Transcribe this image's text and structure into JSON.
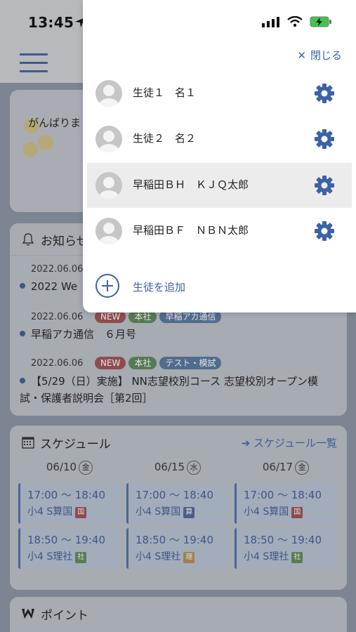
{
  "status_bar": {
    "time": "13:45"
  },
  "panel": {
    "close_label": "閉じる",
    "students": [
      {
        "name": "生徒１　名１",
        "selected": false
      },
      {
        "name": "生徒２　名２",
        "selected": false
      },
      {
        "name": "早稲田ＢＨ　ＫＪＱ太郎",
        "selected": true
      },
      {
        "name": "早稲田ＢＦ　ＮＢＮ太郎",
        "selected": false
      }
    ],
    "add_label": "生徒を追加"
  },
  "banner": {
    "text": "がんばりま"
  },
  "news": {
    "title": "お知らせ",
    "items": [
      {
        "date": "2022.06.06",
        "title": "2022 We",
        "tags": []
      },
      {
        "date": "2022.06.06",
        "title": "早稲アカ通信　６月号",
        "tags": [
          "NEW",
          "本社",
          "早稲アカ通信"
        ]
      },
      {
        "date": "2022.06.06",
        "title": "【5/29（日）実施】 NN志望校別コース 志望校別オープン模",
        "title2": "試・保護者説明会［第2回］",
        "tags": [
          "NEW",
          "本社",
          "テスト・模試"
        ]
      }
    ]
  },
  "schedule": {
    "title": "スケジュール",
    "link": "スケジュール一覧",
    "days": [
      {
        "date": "06/10",
        "weekday": "金",
        "slots": [
          {
            "time": "17:00 〜 18:40",
            "class": "小4 S算国",
            "subject": "国"
          },
          {
            "time": "18:50 〜 19:40",
            "class": "小4 S理社",
            "subject": "社"
          }
        ]
      },
      {
        "date": "06/15",
        "weekday": "水",
        "slots": [
          {
            "time": "17:00 〜 18:40",
            "class": "小4 S算国",
            "subject": "算"
          },
          {
            "time": "18:50 〜 19:40",
            "class": "小4 S理社",
            "subject": "理"
          }
        ]
      },
      {
        "date": "06/17",
        "weekday": "金",
        "slots": [
          {
            "time": "17:00 〜 18:40",
            "class": "小4 S算国",
            "subject": "国"
          },
          {
            "time": "18:50 〜 19:40",
            "class": "小4 S理社",
            "subject": "社"
          }
        ]
      }
    ]
  },
  "points": {
    "title": "ポイント"
  },
  "colors": {
    "accent": "#3d63a6",
    "selected_row": "#ececec",
    "tag_new": "#e0474f",
    "tag_hq": "#3f9b46",
    "tag_category": "#4a78b8"
  },
  "icons": [
    "location-arrow-icon",
    "signal-icon",
    "wifi-icon",
    "battery-charging-icon",
    "hamburger-menu-icon",
    "bell-icon",
    "calendar-icon",
    "arrow-right-icon",
    "points-icon",
    "avatar-icon",
    "gear-icon",
    "close-icon",
    "plus-circle-icon"
  ]
}
